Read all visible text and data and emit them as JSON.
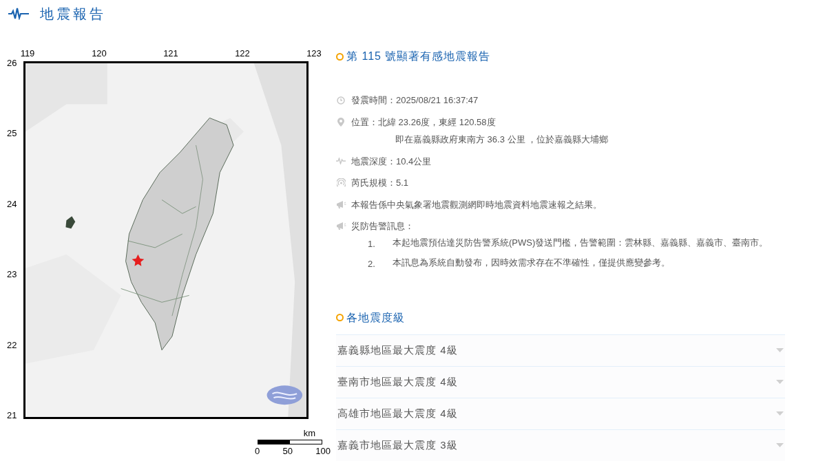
{
  "header": {
    "title": "地震報告"
  },
  "map": {
    "lon_ticks": [
      "119",
      "120",
      "121",
      "122",
      "123"
    ],
    "lat_ticks": [
      "26",
      "25",
      "24",
      "23",
      "22",
      "21"
    ],
    "scale": {
      "unit": "km",
      "labels": [
        "0",
        "50",
        "100"
      ]
    }
  },
  "report": {
    "title": "第 115 號顯著有感地震報告",
    "items": [
      {
        "kind": "time",
        "text": "發震時間：2025/08/21 16:37:47"
      },
      {
        "kind": "location",
        "text": "位置：北緯 23.26度，東經 120.58度",
        "detail": "即在嘉義縣政府東南方 36.3 公里 ，位於嘉義縣大埔鄉"
      },
      {
        "kind": "depth",
        "text": "地震深度：10.4公里"
      },
      {
        "kind": "magnitude",
        "text": "芮氏規模：5.1"
      },
      {
        "kind": "notice",
        "text": "本報告係中央氣象署地震觀測網即時地震資料地震速報之結果。"
      },
      {
        "kind": "notice",
        "text": "災防告警訊息：",
        "list": [
          {
            "number": "1.",
            "text": "本起地震預估達災防告警系統(PWS)發送門檻，告警範圍：雲林縣、嘉義縣、嘉義市、臺南市。"
          },
          {
            "number": "2.",
            "text": "本訊息為系統自動發布，因時效需求存在不準確性，僅提供應變參考。"
          }
        ]
      }
    ]
  },
  "intensity": {
    "title": "各地震度級",
    "rows": [
      {
        "text": "嘉義縣地區最大震度 4級",
        "expanded": false
      },
      {
        "text": "臺南市地區最大震度 4級",
        "expanded": false
      },
      {
        "text": "高雄市地區最大震度 4級",
        "expanded": false
      },
      {
        "text": "嘉義市地區最大震度 3級",
        "expanded": false
      }
    ]
  }
}
